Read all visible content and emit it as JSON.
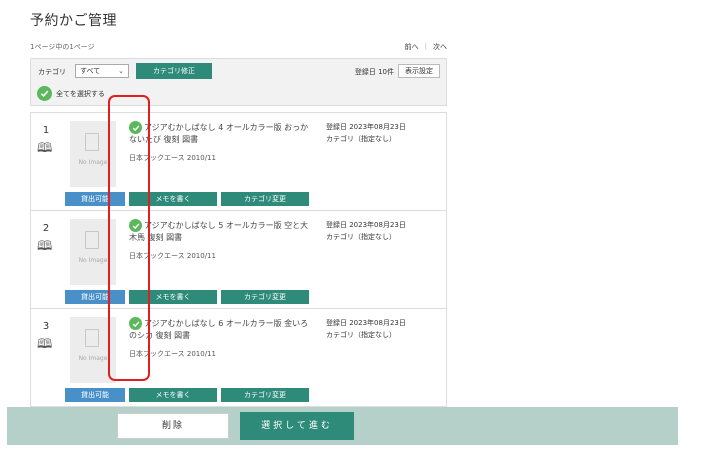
{
  "page": {
    "title": "予約かご管理",
    "page_info": "1ページ中の1ページ"
  },
  "pager": {
    "prev": "前へ",
    "next": "次へ"
  },
  "toolbar": {
    "category_label": "カテゴリ",
    "category_value": "すべて",
    "category_edit": "カテゴリ修正",
    "count": "登録日 10件",
    "display_settings": "表示設定",
    "select_all": "全てを選択する"
  },
  "items": [
    {
      "num": "1",
      "title": "アジアむかしばなし 4 オールカラー版 おっかないたび 復刻 図書",
      "publisher": "日本ブックエース 2010/11",
      "reg": "登録日 2023年08月23日",
      "category": "カテゴリ（指定なし）",
      "no_image": "No Image",
      "loan": "貸出可能",
      "memo": "メモを書く",
      "cat_change": "カテゴリ変更"
    },
    {
      "num": "2",
      "title": "アジアむかしばなし 5 オールカラー版 空と大木馬 復刻 図書",
      "publisher": "日本ブックエース 2010/11",
      "reg": "登録日 2023年08月23日",
      "category": "カテゴリ（指定なし）",
      "no_image": "No Image",
      "loan": "貸出可能",
      "memo": "メモを書く",
      "cat_change": "カテゴリ変更"
    },
    {
      "num": "3",
      "title": "アジアむかしばなし 6 オールカラー版 金いろのシカ 復刻 図書",
      "publisher": "日本ブックエース 2010/11",
      "reg": "登録日 2023年08月23日",
      "category": "カテゴリ（指定なし）",
      "no_image": "No Image",
      "loan": "貸出可能",
      "memo": "メモを書く",
      "cat_change": "カテゴリ変更"
    }
  ],
  "footer": {
    "delete": "削除",
    "proceed": "選択して進む"
  },
  "colors": {
    "accent": "#2e8b7a",
    "loan": "#4a90c8",
    "footer": "#b4d0c9",
    "check": "#5cb85c",
    "highlight": "#e02020"
  }
}
